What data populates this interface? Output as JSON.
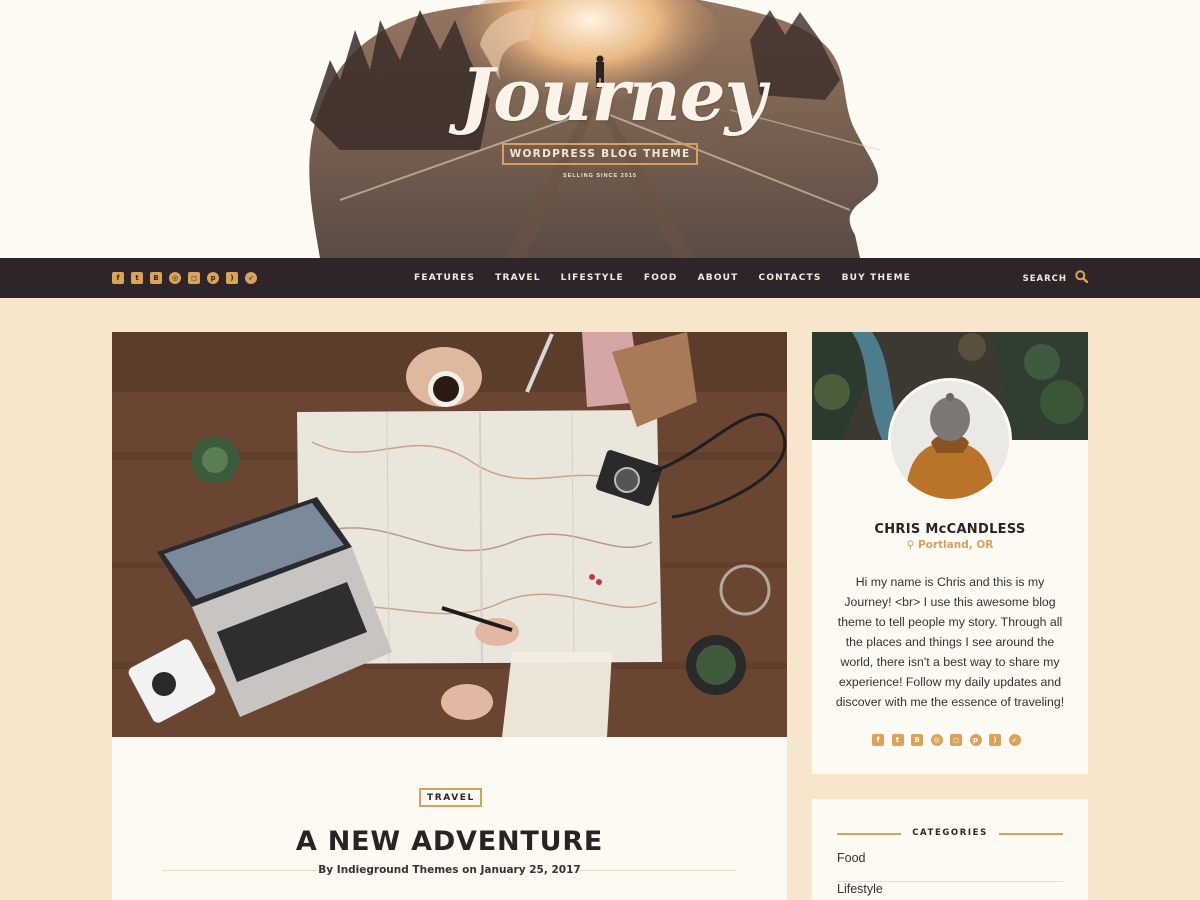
{
  "header": {
    "logo_title": "Journey",
    "logo_subtitle": "WORDPRESS BLOG THEME",
    "logo_tagline": "SELLING SINCE 2015"
  },
  "nav": {
    "social_icons": [
      "facebook-icon",
      "twitter-icon",
      "behance-icon",
      "dribbble-icon",
      "instagram-icon",
      "pinterest-icon",
      "rss-icon",
      "compass-icon"
    ],
    "menu": [
      "FEATURES",
      "TRAVEL",
      "LIFESTYLE",
      "FOOD",
      "ABOUT",
      "CONTACTS",
      "BUY THEME"
    ],
    "search_label": "SEARCH"
  },
  "post": {
    "category": "TRAVEL",
    "title": "A NEW ADVENTURE",
    "meta": "By Indieground Themes on January 25, 2017"
  },
  "profile": {
    "name": "CHRIS McCANDLESS",
    "location": "Portland, OR",
    "bio": "Hi my name is Chris and this is my Journey! <br> I use this awesome blog theme to tell people my story. Through all the places and things I see around the world, there isn't a best way to share my experience! Follow my daily updates and discover with me the essence of traveling!"
  },
  "categories": {
    "heading": "CATEGORIES",
    "items": [
      "Food",
      "Lifestyle"
    ]
  },
  "colors": {
    "nav_bg": "#2f2528",
    "accent_gold": "#d4a15e",
    "page_bg": "#f8e6cc",
    "card_bg": "#fdf9f3"
  }
}
